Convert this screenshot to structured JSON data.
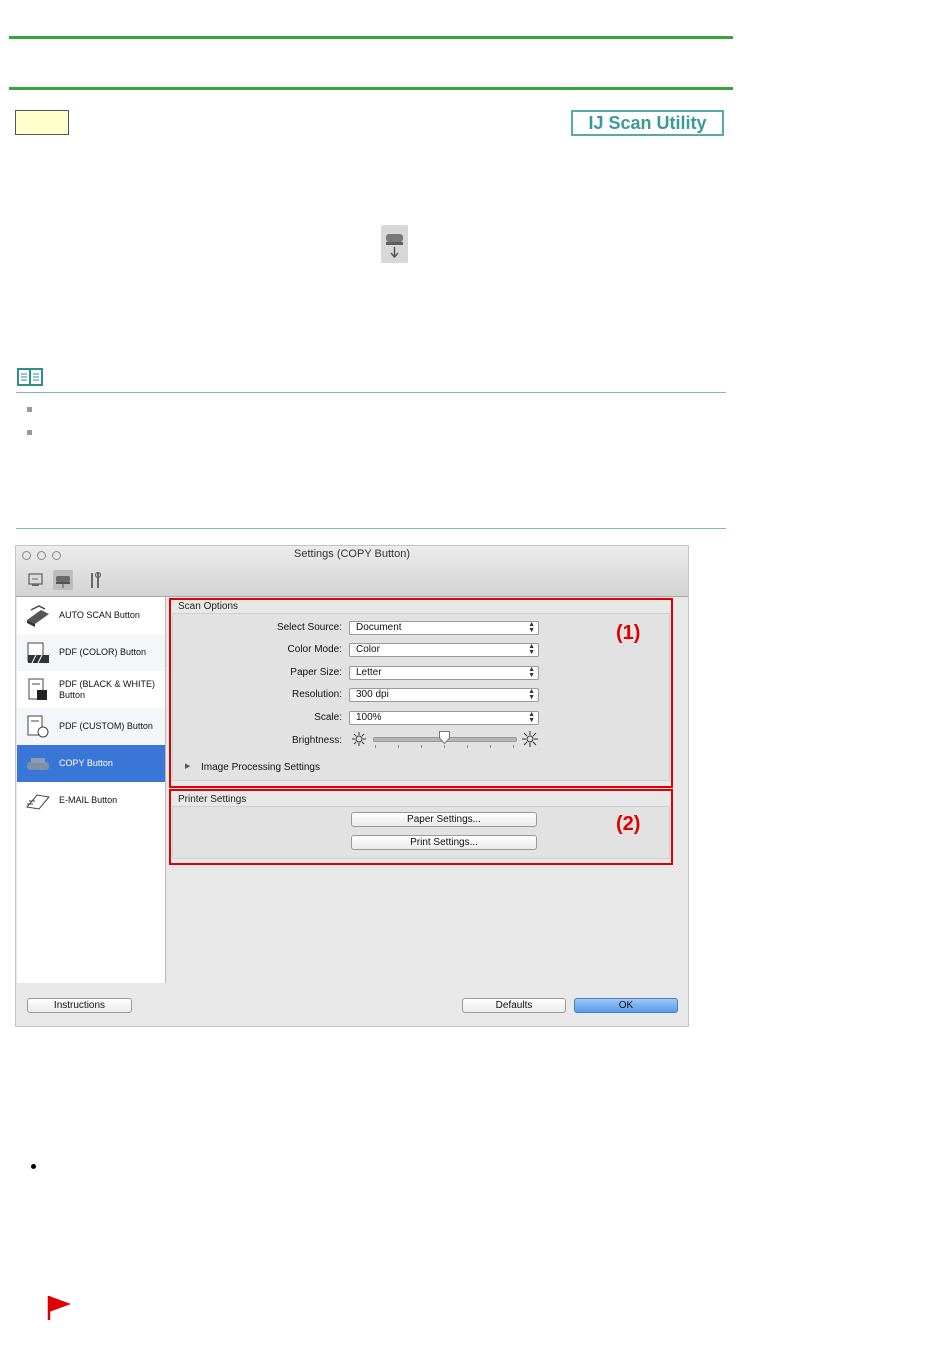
{
  "header": {
    "badge_label": "IJ Scan Utility"
  },
  "icons": {
    "scanner_toolbar": "scanner-icon",
    "note": "book-icon",
    "flag": "flag-icon"
  },
  "colors": {
    "rule_green": "#3aa33a",
    "badge_teal": "#3b9a99",
    "annotation_red": "#e00000",
    "selection_blue": "#3a76d7"
  },
  "settings_window": {
    "title": "Settings (COPY Button)",
    "sidebar": {
      "items": [
        {
          "label": "AUTO SCAN Button"
        },
        {
          "label": "PDF (COLOR) Button"
        },
        {
          "label": "PDF (BLACK & WHITE) Button"
        },
        {
          "label": "PDF (CUSTOM) Button"
        },
        {
          "label": "COPY Button"
        },
        {
          "label": "E-MAIL Button"
        }
      ],
      "selected_index": 4
    },
    "scan_options": {
      "title": "Scan Options",
      "fields": [
        {
          "label": "Select Source:",
          "value": "Document"
        },
        {
          "label": "Color Mode:",
          "value": "Color"
        },
        {
          "label": "Paper Size:",
          "value": "Letter"
        },
        {
          "label": "Resolution:",
          "value": "300 dpi"
        },
        {
          "label": "Scale:",
          "value": "100%"
        }
      ],
      "brightness_label": "Brightness:",
      "brightness_level": 0.5,
      "image_processing_label": "Image Processing Settings",
      "annotation": "(1)"
    },
    "printer_settings": {
      "title": "Printer Settings",
      "paper_button": "Paper Settings...",
      "print_button": "Print Settings...",
      "annotation": "(2)"
    },
    "footer": {
      "instructions": "Instructions",
      "defaults": "Defaults",
      "ok": "OK"
    }
  }
}
